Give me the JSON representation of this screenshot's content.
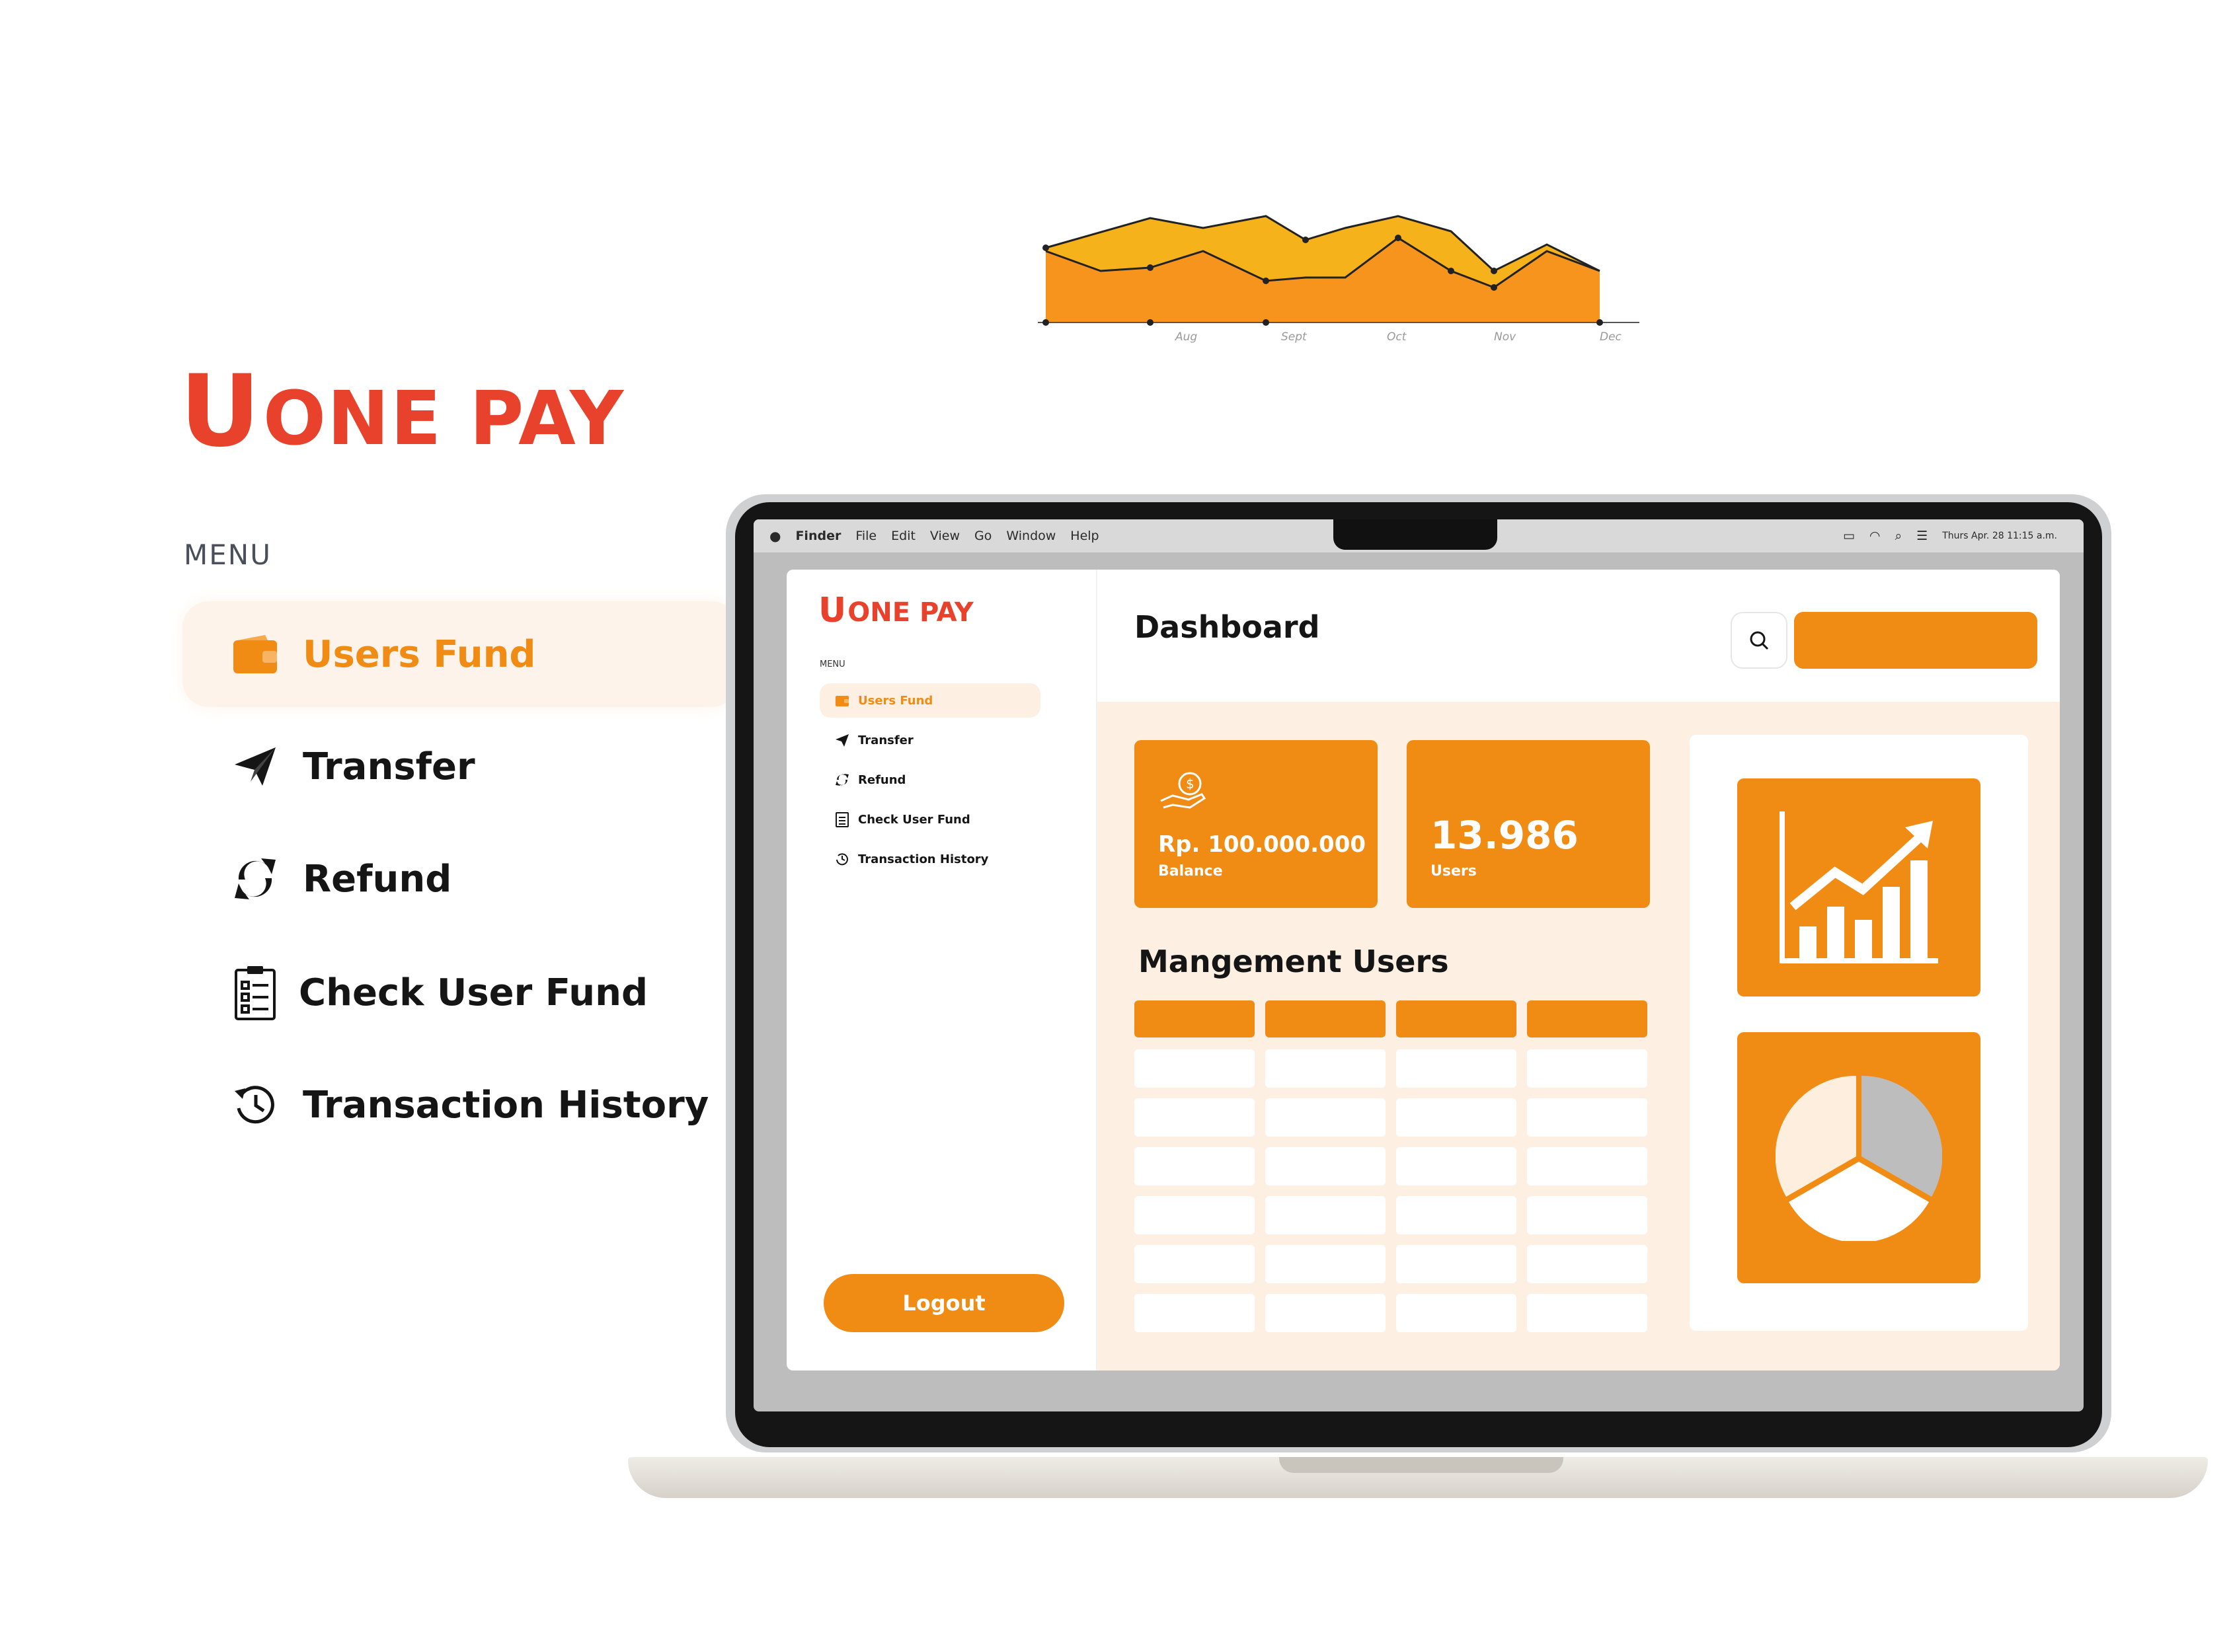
{
  "brand": {
    "logo_u": "U",
    "logo_rest": "ONE PAY"
  },
  "showcase_menu": {
    "heading": "MENU",
    "items": [
      {
        "label": "Users Fund",
        "icon": "wallet-icon",
        "active": true
      },
      {
        "label": "Transfer",
        "icon": "paper-plane-icon",
        "active": false
      },
      {
        "label": "Refund",
        "icon": "refund-arrows-icon",
        "active": false
      },
      {
        "label": "Check User Fund",
        "icon": "clipboard-checklist-icon",
        "active": false
      },
      {
        "label": "Transaction History",
        "icon": "history-clock-icon",
        "active": false
      }
    ]
  },
  "mini_chart": {
    "x_labels": [
      "Aug",
      "Sept",
      "Oct",
      "Nov",
      "Dec"
    ]
  },
  "os_menubar": {
    "items": [
      "Finder",
      "File",
      "Edit",
      "View",
      "Go",
      "Window",
      "Help"
    ],
    "clock": "Thurs Apr. 28  11:15 a.m."
  },
  "app": {
    "sidebar": {
      "heading": "MENU",
      "items": [
        {
          "label": "Users Fund",
          "icon": "wallet-icon"
        },
        {
          "label": "Transfer",
          "icon": "paper-plane-icon"
        },
        {
          "label": "Refund",
          "icon": "refund-arrows-icon"
        },
        {
          "label": "Check User Fund",
          "icon": "clipboard-checklist-icon"
        },
        {
          "label": "Transaction History",
          "icon": "history-clock-icon"
        }
      ],
      "logout_label": "Logout"
    },
    "header": {
      "title": "Dashboard"
    },
    "cards": {
      "balance_value": "Rp. 100.000.000",
      "balance_label": "Balance",
      "users_value": "13.986",
      "users_label": "Users"
    },
    "management": {
      "title": "Mangement Users"
    },
    "colors": {
      "accent": "#f08c14",
      "brand_red": "#e8412c",
      "panel_bg": "#fdf0e3"
    }
  }
}
